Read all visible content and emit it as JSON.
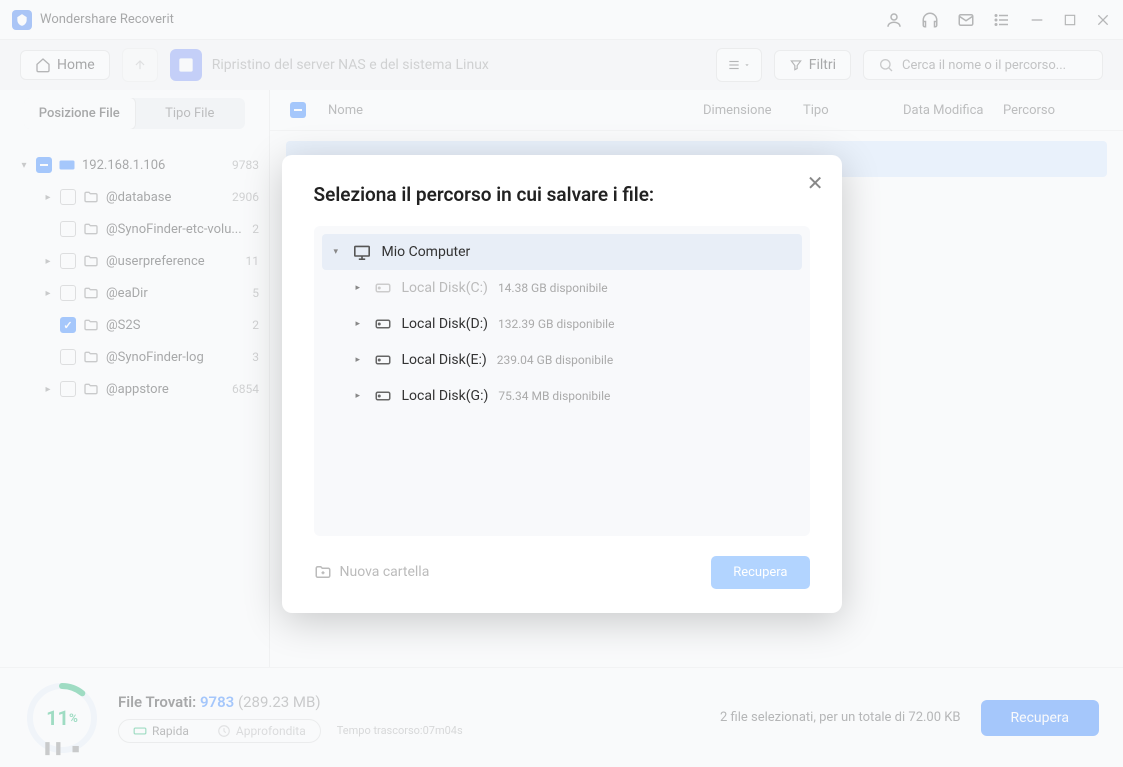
{
  "titlebar": {
    "app_name": "Wondershare Recoverit"
  },
  "toolbar": {
    "home": "Home",
    "breadcrumb": "Ripristino del server NAS e del sistema Linux",
    "filter": "Filtri",
    "search_placeholder": "Cerca il nome o il percorso..."
  },
  "sidebar": {
    "tab_position": "Posizione File",
    "tab_type": "Tipo File",
    "root": {
      "label": "192.168.1.106",
      "count": "9783"
    },
    "items": [
      {
        "label": "@database",
        "count": "2906",
        "checked": false,
        "caret": true
      },
      {
        "label": "@SynoFinder-etc-volu...",
        "count": "2",
        "checked": false,
        "caret": false
      },
      {
        "label": "@userpreference",
        "count": "11",
        "checked": false,
        "caret": true
      },
      {
        "label": "@eaDir",
        "count": "5",
        "checked": false,
        "caret": true
      },
      {
        "label": "@S2S",
        "count": "2",
        "checked": true,
        "caret": false
      },
      {
        "label": "@SynoFinder-log",
        "count": "3",
        "checked": false,
        "caret": false
      },
      {
        "label": "@appstore",
        "count": "6854",
        "checked": false,
        "caret": true
      }
    ]
  },
  "content_head": {
    "name": "Nome",
    "size": "Dimensione",
    "type": "Tipo",
    "date": "Data Modifica",
    "path": "Percorso"
  },
  "footer": {
    "percent": "11",
    "found_label": "File Trovati: ",
    "found_count": "9783",
    "found_size": " (289.23 MB)",
    "toggle_quick": "Rapida",
    "toggle_deep": "Approfondita",
    "elapsed": "Tempo trascorso:07m04s",
    "sel_info": "2 file selezionati, per un totale di 72.00 KB",
    "recover": "Recupera"
  },
  "modal": {
    "title": "Seleziona il percorso in cui salvare i file:",
    "computer": "Mio Computer",
    "drives": [
      {
        "name": "Local Disk(C:)",
        "avail": "14.38 GB disponibile",
        "disabled": true
      },
      {
        "name": "Local Disk(D:)",
        "avail": "132.39 GB disponibile",
        "disabled": false
      },
      {
        "name": "Local Disk(E:)",
        "avail": "239.04 GB disponibile",
        "disabled": false
      },
      {
        "name": "Local Disk(G:)",
        "avail": "75.34 MB disponibile",
        "disabled": false
      }
    ],
    "new_folder": "Nuova cartella",
    "recover": "Recupera"
  }
}
